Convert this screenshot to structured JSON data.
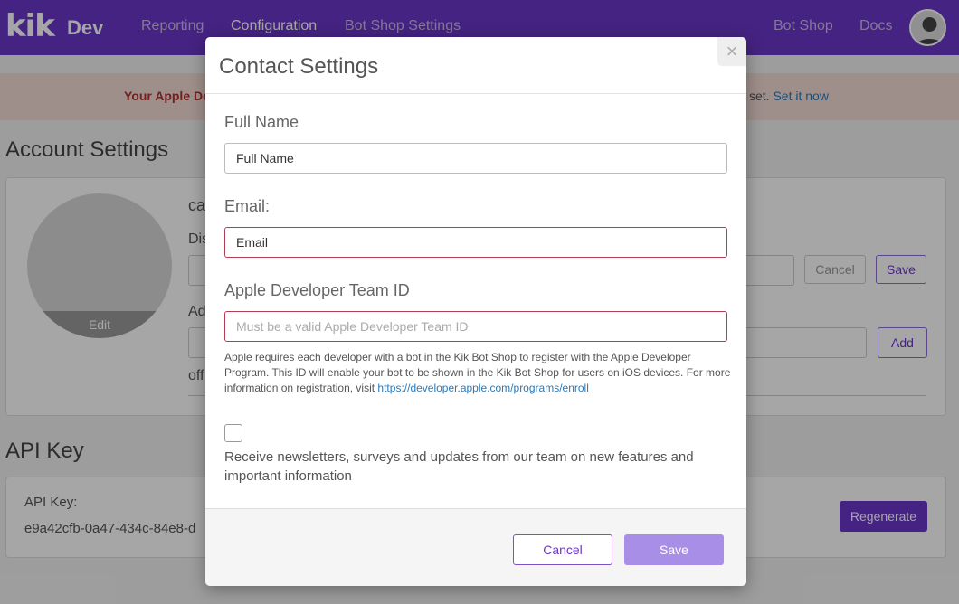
{
  "nav": {
    "logo": "kik",
    "logo_suffix": "Dev",
    "links": [
      "Reporting",
      "Configuration",
      "Bot Shop Settings"
    ],
    "right_links": [
      "Bot Shop",
      "Docs"
    ],
    "avatar_icon": "user-avatar-icon"
  },
  "banner": {
    "message_start": "Your Apple De",
    "message_end": "set.",
    "action": "Set it now"
  },
  "account": {
    "title": "Account Settings",
    "username_partial": "ca",
    "display_label_partial": "Dis",
    "address_label_partial": "Ad",
    "misc_partial": "off",
    "avatar_edit": "Edit",
    "cancel": "Cancel",
    "save": "Save",
    "add": "Add"
  },
  "api": {
    "title": "API Key",
    "label": "API Key:",
    "value_partial": "e9a42cfb-0a47-434c-84e8-d",
    "regenerate": "Regenerate"
  },
  "modal": {
    "title": "Contact Settings",
    "close": "×",
    "full_name_label": "Full Name",
    "full_name_value": "Full Name",
    "email_label": "Email:",
    "email_value": "Email",
    "team_id_label": "Apple Developer Team ID",
    "team_id_placeholder": "Must be a valid Apple Developer Team ID",
    "help_text": "Apple requires each developer with a bot in the Kik Bot Shop to register with the Apple Developer Program. This ID will enable your bot to be shown in the Kik Bot Shop for users on iOS devices. For more information on registration, visit",
    "help_link": "https://developer.apple.com/programs/enroll",
    "newsletter_label": "Receive newsletters, surveys and updates from our team on new features and important information",
    "cancel": "Cancel",
    "save": "Save"
  },
  "colors": {
    "brand": "#6a37c8",
    "error_border": "#b04050",
    "save_disabled": "#a88ee6"
  }
}
